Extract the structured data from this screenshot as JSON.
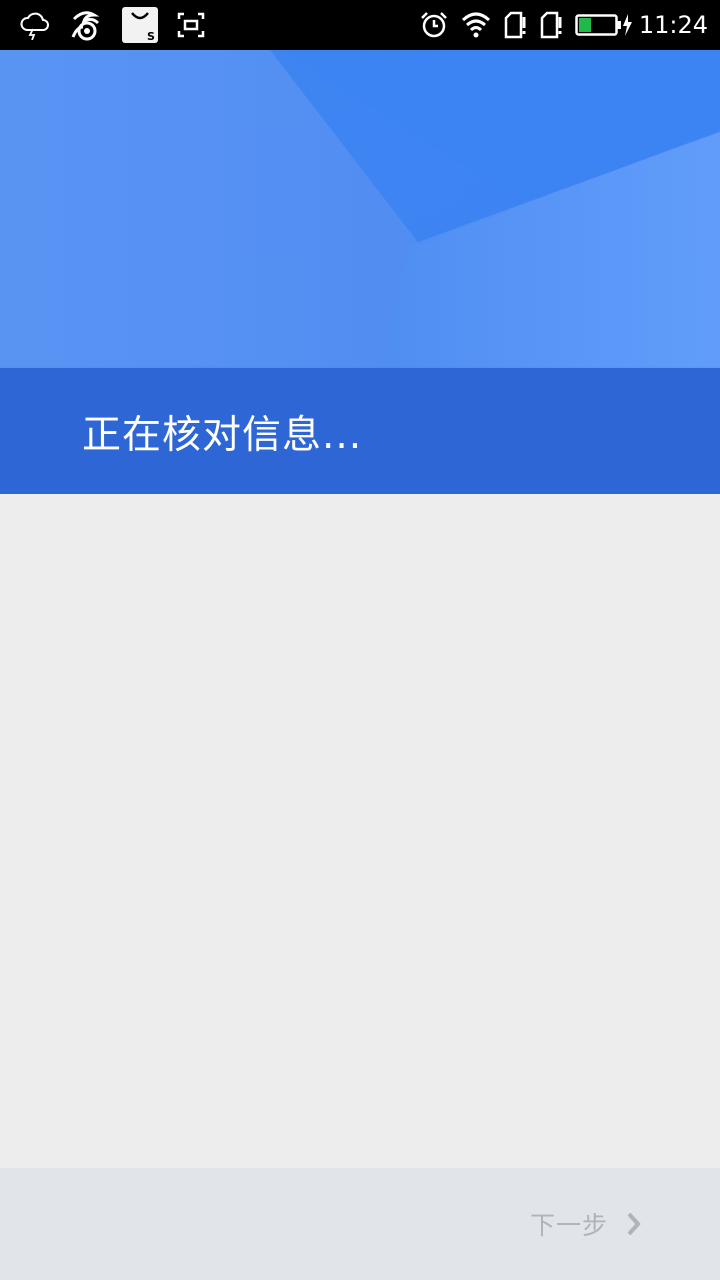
{
  "status_bar": {
    "time": "11:24",
    "icons_left": [
      "weather-cloud-icon",
      "uc-browser-icon",
      "shopping-bag-icon",
      "screenshot-icon"
    ],
    "icons_right": [
      "alarm-icon",
      "wifi-icon",
      "sim1-alert-icon",
      "sim2-alert-icon",
      "battery-charging-icon"
    ],
    "battery_level": 0.35,
    "shopping_bag_letter": "S"
  },
  "header": {
    "title": "正在核对信息..."
  },
  "footer": {
    "next_label": "下一步"
  },
  "colors": {
    "hero_blue": "#4f8cf3",
    "band_blue": "#2f66d5",
    "background": "#ededed",
    "footer_bg": "#e1e5e9",
    "next_text": "#b0b3b8",
    "battery_fill": "#20b94a"
  }
}
